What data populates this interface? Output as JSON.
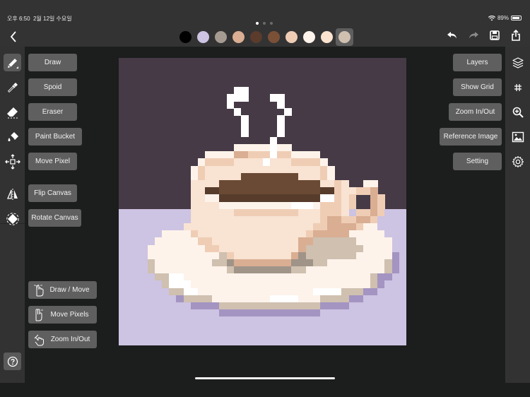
{
  "status_bar": {
    "time": "오후 6:50",
    "date": "2월 12일 수요일",
    "battery": "89%",
    "wifi_icon": "wifi-icon",
    "battery_icon": "battery-icon"
  },
  "topbar": {
    "back_icon": "chevron-left-icon",
    "page_dots": {
      "count": 3,
      "active": 0
    },
    "palette": [
      {
        "color": "#000000",
        "selected": false
      },
      {
        "color": "#cdc3e2",
        "selected": false
      },
      {
        "color": "#a59b91",
        "selected": false
      },
      {
        "color": "#d9ae92",
        "selected": false
      },
      {
        "color": "#5a3b2c",
        "selected": false
      },
      {
        "color": "#7a5137",
        "selected": false
      },
      {
        "color": "#efcdb5",
        "selected": false
      },
      {
        "color": "#fdf3ea",
        "selected": false
      },
      {
        "color": "#fbe3d0",
        "selected": false
      },
      {
        "color": "#cfc0b0",
        "selected": true
      }
    ],
    "actions": [
      "undo-icon",
      "redo-icon",
      "save-icon",
      "share-icon"
    ]
  },
  "left_tools": [
    {
      "icon": "pencil-icon",
      "label": "Draw",
      "selected": true
    },
    {
      "icon": "eyedropper-icon",
      "label": "Spoid",
      "selected": false
    },
    {
      "icon": "eraser-icon",
      "label": "Eraser",
      "selected": false
    },
    {
      "icon": "paint-bucket-icon",
      "label": "Paint Bucket",
      "selected": false
    },
    {
      "icon": "move-icon",
      "label": "Move Pixel",
      "selected": false
    },
    {
      "icon": "flip-icon",
      "label": "Flip Canvas",
      "selected": false
    },
    {
      "icon": "rotate-icon",
      "label": "Rotate Canvas",
      "selected": false
    }
  ],
  "gestures": [
    {
      "icon": "one-finger-icon",
      "label": "Draw / Move"
    },
    {
      "icon": "two-finger-icon",
      "label": "Move Pixels"
    },
    {
      "icon": "pinch-icon",
      "label": "Zoom In/Out"
    }
  ],
  "help_icon": "help-icon",
  "right_tools": [
    {
      "icon": "layers-icon",
      "label": "Layers"
    },
    {
      "icon": "grid-icon",
      "label": "Show Grid"
    },
    {
      "icon": "zoom-icon",
      "label": "Zoom In/Out"
    },
    {
      "icon": "image-icon",
      "label": "Reference Image"
    },
    {
      "icon": "gear-icon",
      "label": "Setting"
    }
  ],
  "canvas": {
    "grid": 40,
    "subject": "pixel art coffee cup on saucer",
    "colors": {
      "B": "#463a47",
      "L": "#cdc3e2",
      "W": "#ffffff",
      "C": "#fdf3ea",
      "P": "#f9e3d2",
      "T": "#efcdb5",
      "D": "#d9ae92",
      "K": "#6b4a35",
      "N": "#573c2c",
      "G": "#cfc0b0",
      "H": "#a09488",
      "V": "#a394c2"
    },
    "rows": [
      "BBBBBBBBBBBBBBBBBBBBBBBBBBBBBBBBBBBBBBBB",
      "BBBBBBBBBBBBBBBBBBBBBBBBBBBBBBBBBBBBBBBB",
      "BBBBBBBBBBBBBBBBBBBBBBBBBBBBBBBBBBBBBBBB",
      "BBBBBBBBBBBBBBBBBBBBBBBBBBBBBBBBBBBBBBBB",
      "BBBBBBBBBBBBBBBBWWBBBBBBBBBBBBBBBBBBBBBB",
      "BBBBBBBBBBBBBBBWWWBBBWWBBBBBBBBBBBBBBBBB",
      "BBBBBBBBBBBBBBBWBBBBBBWBBBBBBBBBBBBBBBBB",
      "BBBBBBBBBBBBBBBBWBBBBBBWBBBBBBBBBBBBBBBB",
      "BBBBBBBBBBBBBBBBBWBBBBWBBBBBBBBBBBBBBBBB",
      "BBBBBBBBBBBBBBBBBWBBBBWBBBBBBBBBBBBBBBBB",
      "BBBBBBBBBBBBBBBBBWBBBBWBBBBBBBBBBBBBBBBB",
      "BBBBBBBBBBBBBBBBBBBBBWBBBBBBBBBBBBBBBBBB",
      "BBBBBBBBBBBBBBBBCCCCCWCCBBBBBBBBBBBBBBBB",
      "BBBBBBBBBBBBCCCCDDTTTWTTCCCCBBBBBBBBBBBB",
      "BBBBBBBBBBBCTTTTPPPPWPPPTTTTCBBBBBBBBBBB",
      "BBBBBBBBBBCTPPPPPPPPPPPPPPPPTCBBBBBBBBBB",
      "BBBBBBBBBBCTPPPPPKKKKKKKKPPPTCBBBBBBBBBB",
      "BBBBBBBBBBPPPPKKKKKKKKKKKKKKPPTPBBCCBBBB",
      "BBBBBBBBBBPPNNKKKKKKKKKKKKKKNNTPPTTDBBBB",
      "BBBBBBBBBBPPCCNNNNNNNNNNNNNNWWTPTBBDTBBB",
      "BBBBBBBBBBPPPPCCCCCCCCCCWWWCTTTPTBBDTBBB",
      "LLLLLLLLLLPPPPPPTTTTTTTTTPPPTTTPLTTDTLLL",
      "LLLLLLLLLLPPPPPPPPPPPPPPPPPPTDDTTDDTLLLL",
      "LLLLLLLLLPPPPPPPPPPPPPPPPPPTTDDDDTCCLLLL",
      "LLLLLLCCCCTPPPPPPPPPPPPPPPTDDDDDCCCCCLLL",
      "LLLLLCCCCCCTTPPPPPPPPPPPPDDGGGGGGCCCCCLL",
      "LLLLCCCCCCCCTTPPPPPPPPPPPDGGGGGGGGCCCCLL",
      "LLLLCCCCCCCCCCGTPPPPPPPPDHGGGGGGGCCCCCVL",
      "LLLLGCCCCCCCCGGHDDDDDDDDHHHGGCCCCCCCCGVL",
      "LLLLGCCCCCCCCCCGHHHHHHHHGGCCCCCCCCCCCGVL",
      "LLLLLGGWWCCCCCCCCCCCCCCCCCCCCCCCCCCGVVLL",
      "LLLLLLGWWWCCCCCCCCCCCCCCCCCCCCCCCCCGVLLL",
      "LLLLLLLGGWWCCCCCCCCCCCCCCCCWWWWGGGVVLLLL",
      "LLLLLLLLVGGGGCCCCCCCCWWWWCCCGGGGVVLLLLLL",
      "LLLLLLLLLLVVVVGGGGGGGGGGGGGGVVVVLLLLLLLL",
      "LLLLLLLLLLLLLLVVVVVVVVVVVVVVLLLLLLLLLLLL",
      "LLLLLLLLLLLLLLLLLLLLLLLLLLLLLLLLLLLLLLLL",
      "LLLLLLLLLLLLLLLLLLLLLLLLLLLLLLLLLLLLLLLL",
      "LLLLLLLLLLLLLLLLLLLLLLLLLLLLLLLLLLLLLLLL",
      "LLLLLLLLLLLLLLLLLLLLLLLLLLLLLLLLLLLLLLLL"
    ]
  }
}
